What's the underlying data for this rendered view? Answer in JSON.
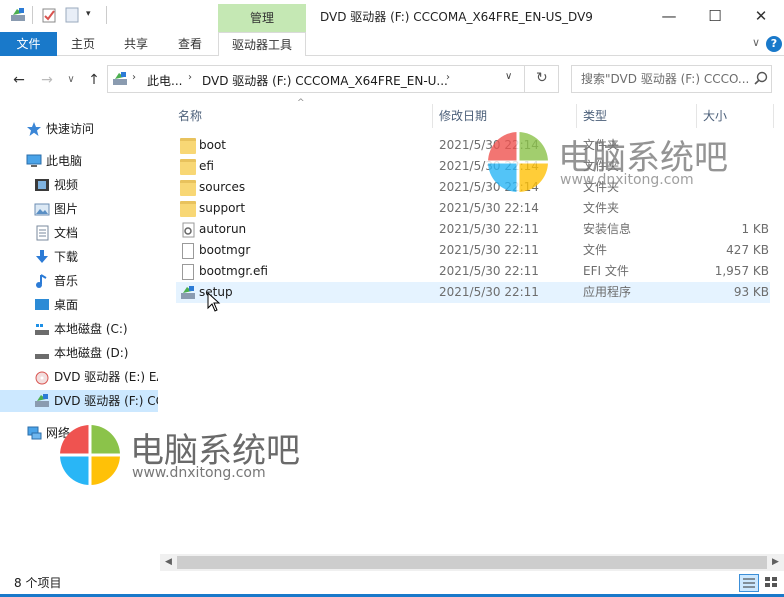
{
  "window": {
    "title": "DVD 驱动器 (F:) CCCOMA_X64FRE_EN-US_DV9",
    "context_tab": "管理",
    "minimize": "—",
    "maximize": "☐",
    "close": "✕"
  },
  "ribbon": {
    "tabs": [
      "文件",
      "主页",
      "共享",
      "查看",
      "驱动器工具"
    ],
    "help": "?"
  },
  "nav": {
    "back": "←",
    "forward": "→",
    "recent": "∨",
    "up": "↑",
    "breadcrumb": [
      "此电...",
      "DVD 驱动器 (F:) CCCOMA_X64FRE_EN-U..."
    ],
    "refresh": "↻",
    "search_placeholder": "搜索\"DVD 驱动器 (F:) CCCO..."
  },
  "sidebar": {
    "items": [
      {
        "label": "快速访问",
        "icon": "star-icon"
      },
      {
        "label": "此电脑",
        "icon": "computer-icon"
      },
      {
        "label": "视频",
        "icon": "video-icon"
      },
      {
        "label": "图片",
        "icon": "picture-icon"
      },
      {
        "label": "文档",
        "icon": "document-icon"
      },
      {
        "label": "下载",
        "icon": "download-icon"
      },
      {
        "label": "音乐",
        "icon": "music-icon"
      },
      {
        "label": "桌面",
        "icon": "desktop-icon"
      },
      {
        "label": "本地磁盘 (C:)",
        "icon": "drive-icon"
      },
      {
        "label": "本地磁盘 (D:)",
        "icon": "drive-icon"
      },
      {
        "label": "DVD 驱动器 (E:) EA",
        "icon": "dvd-icon"
      },
      {
        "label": "DVD 驱动器 (F:) CC",
        "icon": "dvd-setup-icon"
      },
      {
        "label": "网络",
        "icon": "network-icon"
      }
    ]
  },
  "filelist": {
    "columns": {
      "name": "名称",
      "date": "修改日期",
      "type": "类型",
      "size": "大小"
    },
    "rows": [
      {
        "name": "boot",
        "date": "2021/5/30 22:14",
        "type": "文件夹",
        "size": "",
        "icon": "folder-icon"
      },
      {
        "name": "efi",
        "date": "2021/5/30 22:14",
        "type": "文件夹",
        "size": "",
        "icon": "folder-icon"
      },
      {
        "name": "sources",
        "date": "2021/5/30 22:14",
        "type": "文件夹",
        "size": "",
        "icon": "folder-icon"
      },
      {
        "name": "support",
        "date": "2021/5/30 22:14",
        "type": "文件夹",
        "size": "",
        "icon": "folder-icon"
      },
      {
        "name": "autorun",
        "date": "2021/5/30 22:11",
        "type": "安装信息",
        "size": "1 KB",
        "icon": "settings-file-icon"
      },
      {
        "name": "bootmgr",
        "date": "2021/5/30 22:11",
        "type": "文件",
        "size": "427 KB",
        "icon": "file-icon"
      },
      {
        "name": "bootmgr.efi",
        "date": "2021/5/30 22:11",
        "type": "EFI 文件",
        "size": "1,957 KB",
        "icon": "file-icon"
      },
      {
        "name": "setup",
        "date": "2021/5/30 22:11",
        "type": "应用程序",
        "size": "93 KB",
        "icon": "setup-icon"
      }
    ]
  },
  "status": {
    "count": "8 个项目"
  },
  "watermark": {
    "name": "电脑系统吧",
    "url": "www.dnxitong.com"
  }
}
